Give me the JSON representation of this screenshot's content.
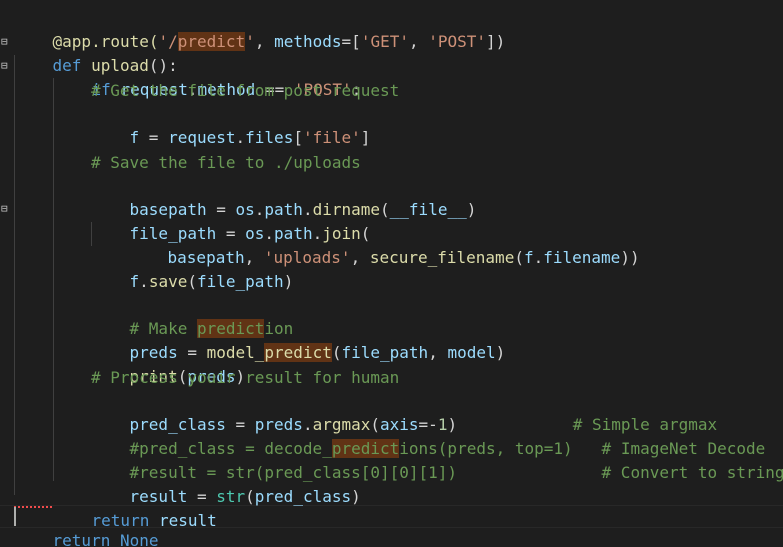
{
  "code": {
    "l1": [
      "@app",
      ".route(",
      "'/",
      "predict",
      "'",
      ", ",
      "methods",
      "=[",
      "'GET'",
      ", ",
      "'POST'",
      "])"
    ],
    "l2": [
      "def",
      " ",
      "upload",
      "():"
    ],
    "l3": [
      "if",
      " ",
      "request",
      ".",
      "method",
      " == ",
      "'POST'",
      ":"
    ],
    "l4": "# Get the file from post request",
    "l5": [
      "f",
      " = ",
      "request",
      ".",
      "files",
      "[",
      "'file'",
      "]"
    ],
    "l7": "# Save the file to ./uploads",
    "l8": [
      "basepath",
      " = ",
      "os",
      ".",
      "path",
      ".",
      "dirname",
      "(",
      "__file__",
      ")"
    ],
    "l9": [
      "file_path",
      " = ",
      "os",
      ".",
      "path",
      ".",
      "join",
      "("
    ],
    "l10": [
      "basepath",
      ", ",
      "'uploads'",
      ", ",
      "secure_filename",
      "(",
      "f",
      ".",
      "filename",
      "))"
    ],
    "l11": [
      "f",
      ".",
      "save",
      "(",
      "file_path",
      ")"
    ],
    "l13": [
      "# Make ",
      "predict",
      "ion"
    ],
    "l14": [
      "preds",
      " = ",
      "model_",
      "predict",
      "(",
      "file_path",
      ", ",
      "model",
      ")"
    ],
    "l15": [
      "print",
      "(",
      "preds",
      ")"
    ],
    "l16": "# Process youir result for human",
    "l17": [
      "pred_class",
      " = ",
      "preds",
      ".",
      "argmax",
      "(",
      "axis",
      "=-",
      "1",
      ")",
      "            ",
      "# Simple argmax"
    ],
    "l18": [
      "#pred_class = decode_",
      "predict",
      "ions(preds, top=1)",
      "   # ImageNet Decode"
    ],
    "l19": [
      "#result = str(pred_class[0][0][1])",
      "               # Convert to string"
    ],
    "l20": [
      "result",
      " = ",
      "str",
      "(",
      "pred_class",
      ")"
    ],
    "l21": [
      "return",
      " ",
      "result"
    ],
    "l22": [
      "return",
      " ",
      "None"
    ]
  }
}
